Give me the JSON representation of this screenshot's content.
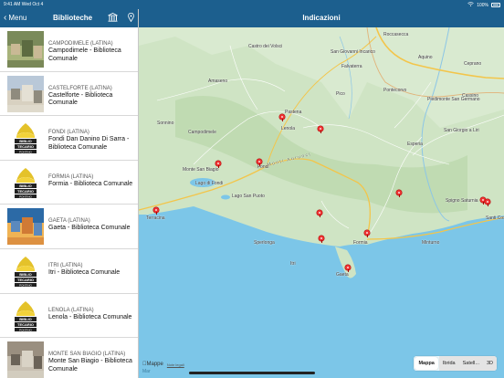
{
  "status_bar": {
    "time": "9:41 AM",
    "date": "Wed Oct 4",
    "battery": "100%"
  },
  "nav": {
    "back_label": "Menu",
    "left_title": "Biblioteche",
    "center_title": "Indicazioni",
    "icons": [
      "library-icon",
      "location-icon"
    ]
  },
  "libraries": [
    {
      "sub": "CAMPODIMELE (LATINA)",
      "title": "Campodimele - Biblioteca Comunale",
      "thumb": "photo-village"
    },
    {
      "sub": "CASTELFORTE (LATINA)",
      "title": "Castelforte - Biblioteca Comunale",
      "thumb": "photo-town"
    },
    {
      "sub": "FONDI (LATINA)",
      "title": "Fondi Dan Danino Di Sarra - Biblioteca Comunale",
      "thumb": "logo"
    },
    {
      "sub": "FORMIA (LATINA)",
      "title": "Formia - Biblioteca Comunale",
      "thumb": "logo"
    },
    {
      "sub": "GAETA (LATINA)",
      "title": "Gaeta - Biblioteca Comunale",
      "thumb": "photo-coast"
    },
    {
      "sub": "ITRI (LATINA)",
      "title": "Itri - Biblioteca Comunale",
      "thumb": "logo"
    },
    {
      "sub": "LENOLA (LATINA)",
      "title": "Lenola - Biblioteca Comunale",
      "thumb": "logo"
    },
    {
      "sub": "MONTE SAN BIAGIO (LATINA)",
      "title": "Monte San Biagio - Biblioteca Comunale",
      "thumb": "photo-building"
    }
  ],
  "logo_text": [
    "BIBLIO",
    "TECARIO",
    "PONTINO"
  ],
  "map": {
    "places": [
      {
        "name": "Castro dei Volsci",
        "big": false
      },
      {
        "name": "Roccasecca",
        "big": false
      },
      {
        "name": "San Giovanni Incarico",
        "big": false
      },
      {
        "name": "Aquino",
        "big": false
      },
      {
        "name": "Ceprano",
        "big": false
      },
      {
        "name": "Falvaterra",
        "big": false
      },
      {
        "name": "Amaseno",
        "big": false
      },
      {
        "name": "Pico",
        "big": false
      },
      {
        "name": "Pontecorvo",
        "big": false
      },
      {
        "name": "Cassino",
        "big": false
      },
      {
        "name": "Piedimonte San Germano",
        "big": false
      },
      {
        "name": "Sonnino",
        "big": false
      },
      {
        "name": "Lenola",
        "big": false
      },
      {
        "name": "Pastena",
        "big": false
      },
      {
        "name": "Esperia",
        "big": false
      },
      {
        "name": "San Giorgio a Liri",
        "big": false
      },
      {
        "name": "Campodimele",
        "big": false
      },
      {
        "name": "Monte San Biagio",
        "big": false
      },
      {
        "name": "Fondi",
        "big": false
      },
      {
        "name": "Itri",
        "big": false
      },
      {
        "name": "Spigno Saturnia",
        "big": false
      },
      {
        "name": "Minturno",
        "big": false
      },
      {
        "name": "Terracina",
        "big": false
      },
      {
        "name": "Sperlonga",
        "big": false
      },
      {
        "name": "Formia",
        "big": false
      },
      {
        "name": "Gaeta",
        "big": false
      },
      {
        "name": "Santi Cosma",
        "big": false
      },
      {
        "name": "Lago di Fondi",
        "big": false
      },
      {
        "name": "Lago San Puoto",
        "big": false
      },
      {
        "name": "Monti Aurunci",
        "big": false
      }
    ],
    "attribution": "Mappe",
    "legal": "Note legali",
    "mode_buttons": [
      "Mappa",
      "Ibrida",
      "Satell...",
      "3D"
    ],
    "active_mode": "Mappa"
  },
  "colors": {
    "bar": "#1c5f8e",
    "pin": "#e33333",
    "sea": "#7cc6e8",
    "land": "#cfe4c4"
  }
}
